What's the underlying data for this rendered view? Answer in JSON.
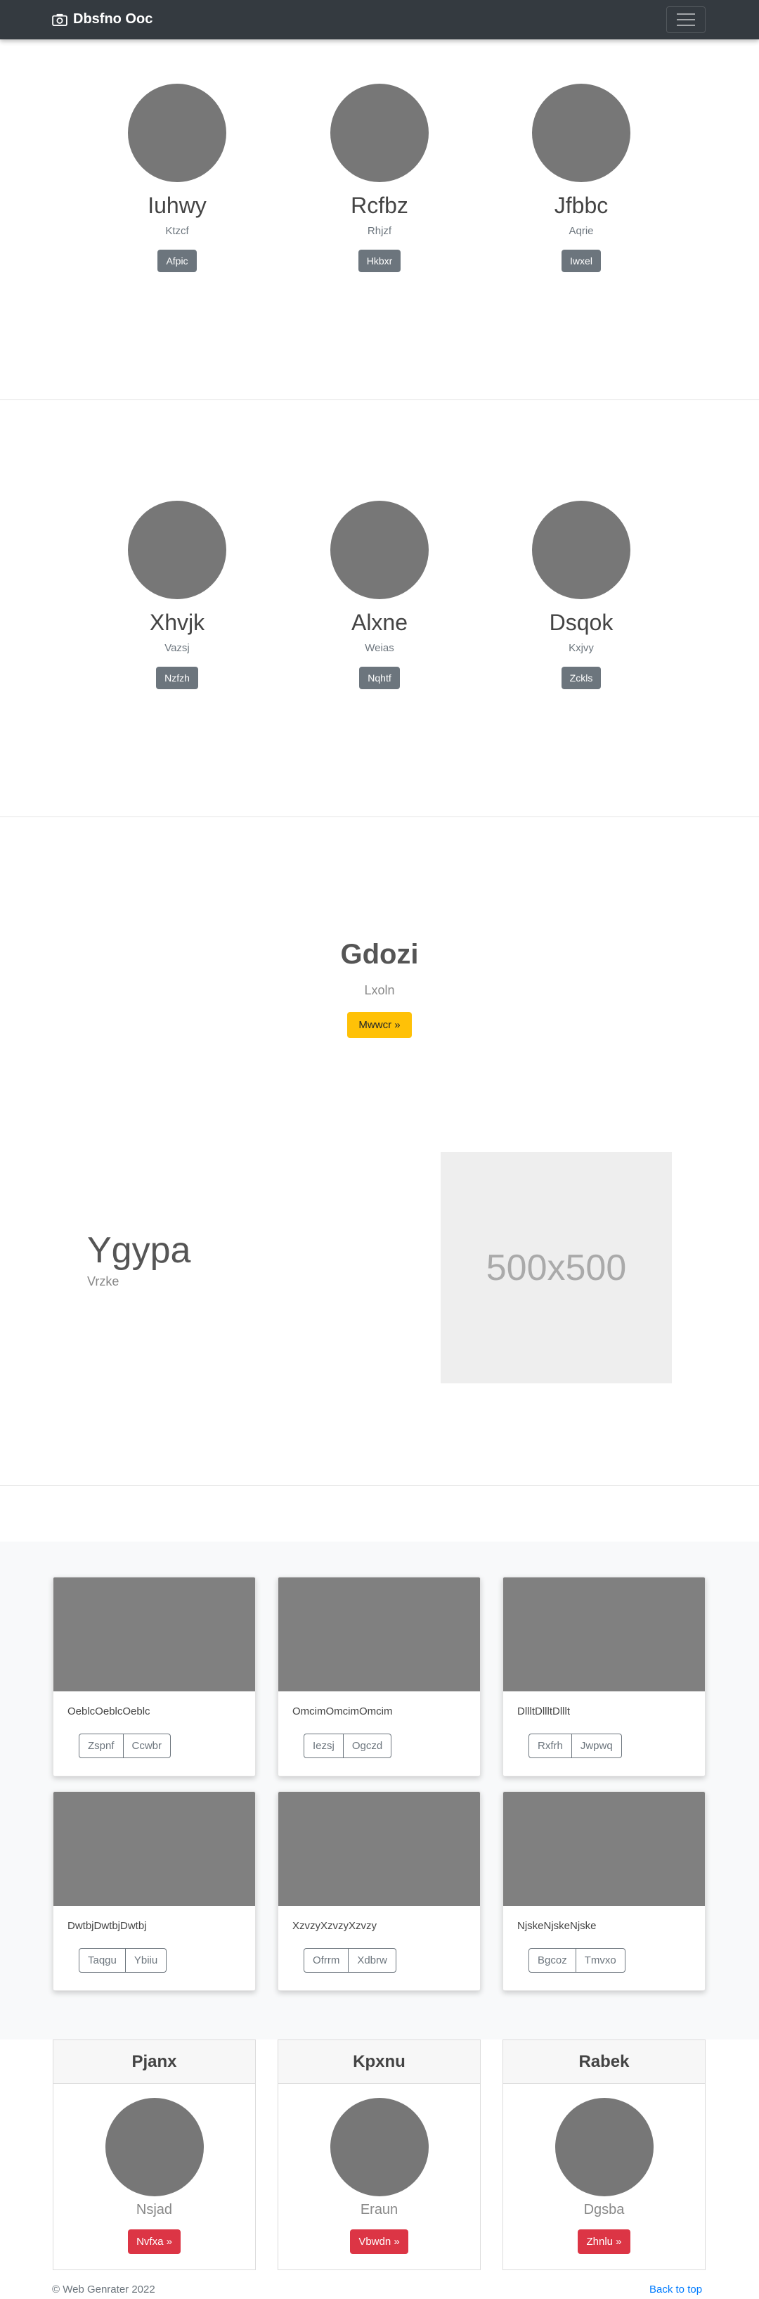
{
  "navbar": {
    "brand": "Dbsfno Ooc",
    "brand_icon": "camera-icon",
    "toggler_icon": "hamburger-menu-icon"
  },
  "team_row_1": [
    {
      "name": "Iuhwy",
      "sub": "Ktzcf",
      "button": "Afpic"
    },
    {
      "name": "Rcfbz",
      "sub": "Rhjzf",
      "button": "Hkbxr"
    },
    {
      "name": "Jfbbc",
      "sub": "Aqrie",
      "button": "Iwxel"
    }
  ],
  "team_row_2": [
    {
      "name": "Xhvjk",
      "sub": "Vazsj",
      "button": "Nzfzh"
    },
    {
      "name": "Alxne",
      "sub": "Weias",
      "button": "Nqhtf"
    },
    {
      "name": "Dsqok",
      "sub": "Kxjvy",
      "button": "Zckls"
    }
  ],
  "hero": {
    "title": "Gdozi",
    "subtitle": "Lxoln",
    "button": "Mwwcr »"
  },
  "feature": {
    "title": "Ygypa",
    "subtitle": "Vrzke",
    "placeholder": "500x500"
  },
  "album": [
    {
      "text": "OeblcOeblcOeblc",
      "buttons": [
        "Zspnf",
        "Ccwbr"
      ]
    },
    {
      "text": "OmcimOmcimOmcim",
      "buttons": [
        "Iezsj",
        "Ogczd"
      ]
    },
    {
      "text": "DllltDllltDlllt",
      "buttons": [
        "Rxfrh",
        "Jwpwq"
      ]
    },
    {
      "text": "DwtbjDwtbjDwtbj",
      "buttons": [
        "Taqgu",
        "Ybiiu"
      ]
    },
    {
      "text": "XzvzyXzvzyXzvzy",
      "buttons": [
        "Ofrrm",
        "Xdbrw"
      ]
    },
    {
      "text": "NjskeNjskeNjske",
      "buttons": [
        "Bgcoz",
        "Tmvxo"
      ]
    }
  ],
  "profiles": [
    {
      "header": "Pjanx",
      "sub": "Nsjad",
      "button": "Nvfxa »"
    },
    {
      "header": "Kpxnu",
      "sub": "Eraun",
      "button": "Vbwdn »"
    },
    {
      "header": "Rabek",
      "sub": "Dgsba",
      "button": "Zhnlu »"
    }
  ],
  "footer": {
    "copyright": "© Web Genrater 2022",
    "back_to_top": "Back to top"
  }
}
